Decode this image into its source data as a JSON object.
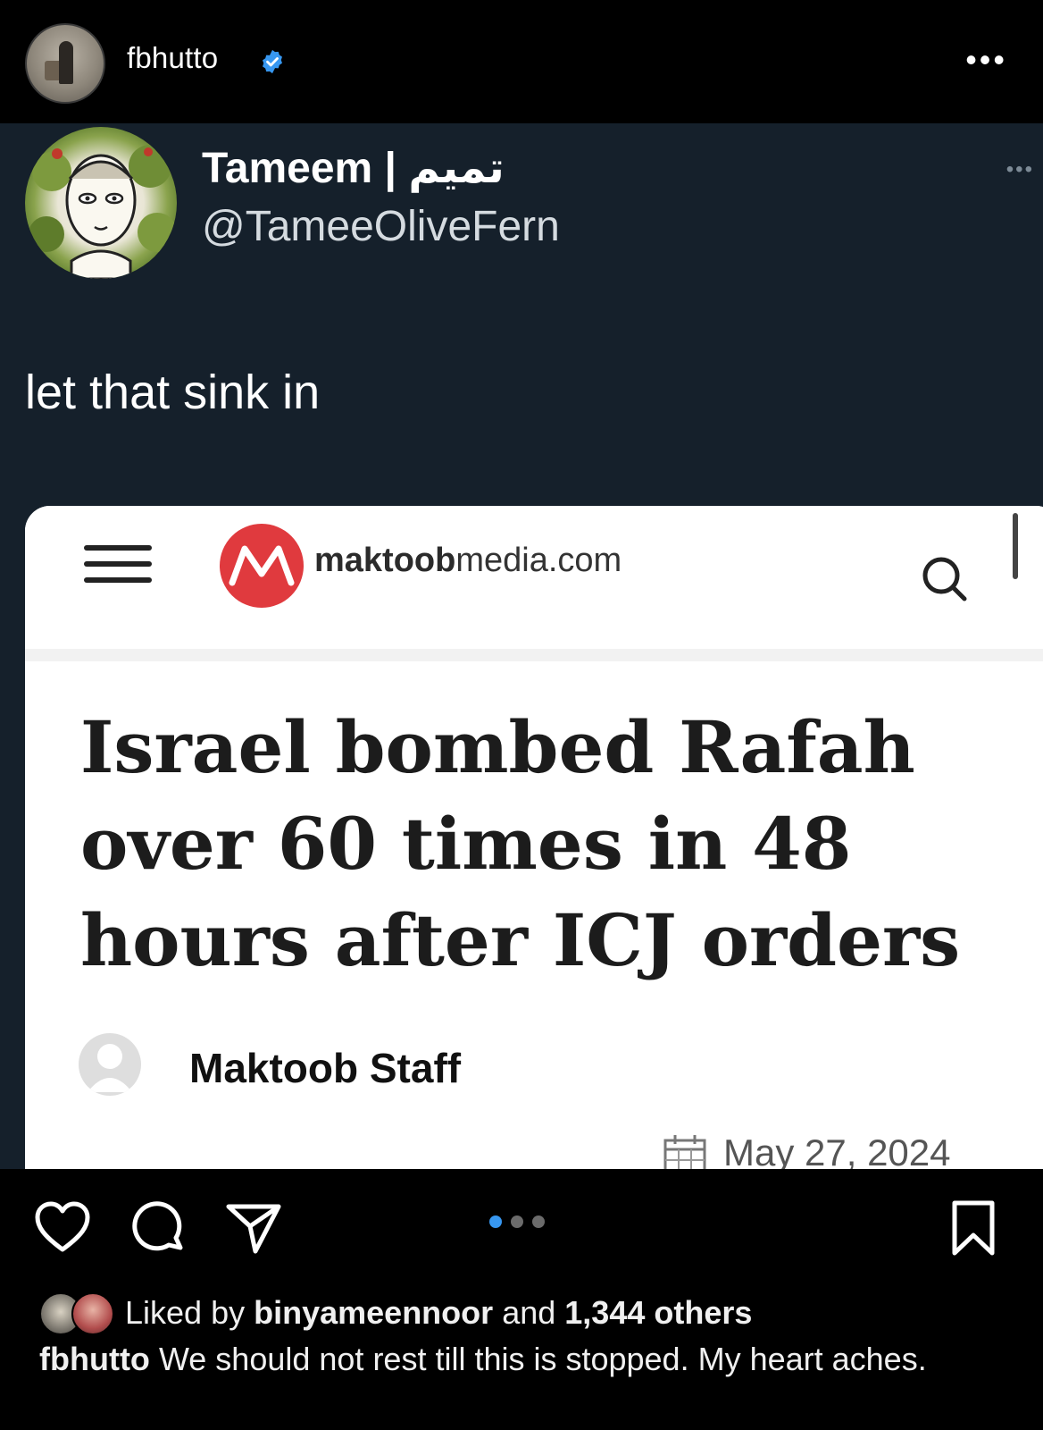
{
  "post": {
    "username": "fbhutto",
    "verified": true,
    "more_label": "•••"
  },
  "tweet": {
    "display_name": "Tameem | تميم",
    "handle": "@TameeOliveFern",
    "more_label": "•••",
    "text": "let that sink in",
    "embedded_article": {
      "site_name_bold": "maktoob",
      "site_name_rest": "media.com",
      "headline": "Israel bombed Rafah over 60 times in 48 hours after ICJ orders",
      "author": "Maktoob Staff",
      "date": "May 27, 2024"
    }
  },
  "actions": {
    "carousel_count": 3,
    "carousel_active": 0
  },
  "likes": {
    "prefix": "Liked by",
    "user": "binyameennoor",
    "middle": "and",
    "others": "1,344 others"
  },
  "caption": {
    "author": "fbhutto",
    "text": "We should not rest till this is stopped. My heart aches."
  },
  "colors": {
    "tweet_bg": "#15202b",
    "verified_blue": "#3797f0",
    "maktoob_red": "#e03a3e"
  }
}
